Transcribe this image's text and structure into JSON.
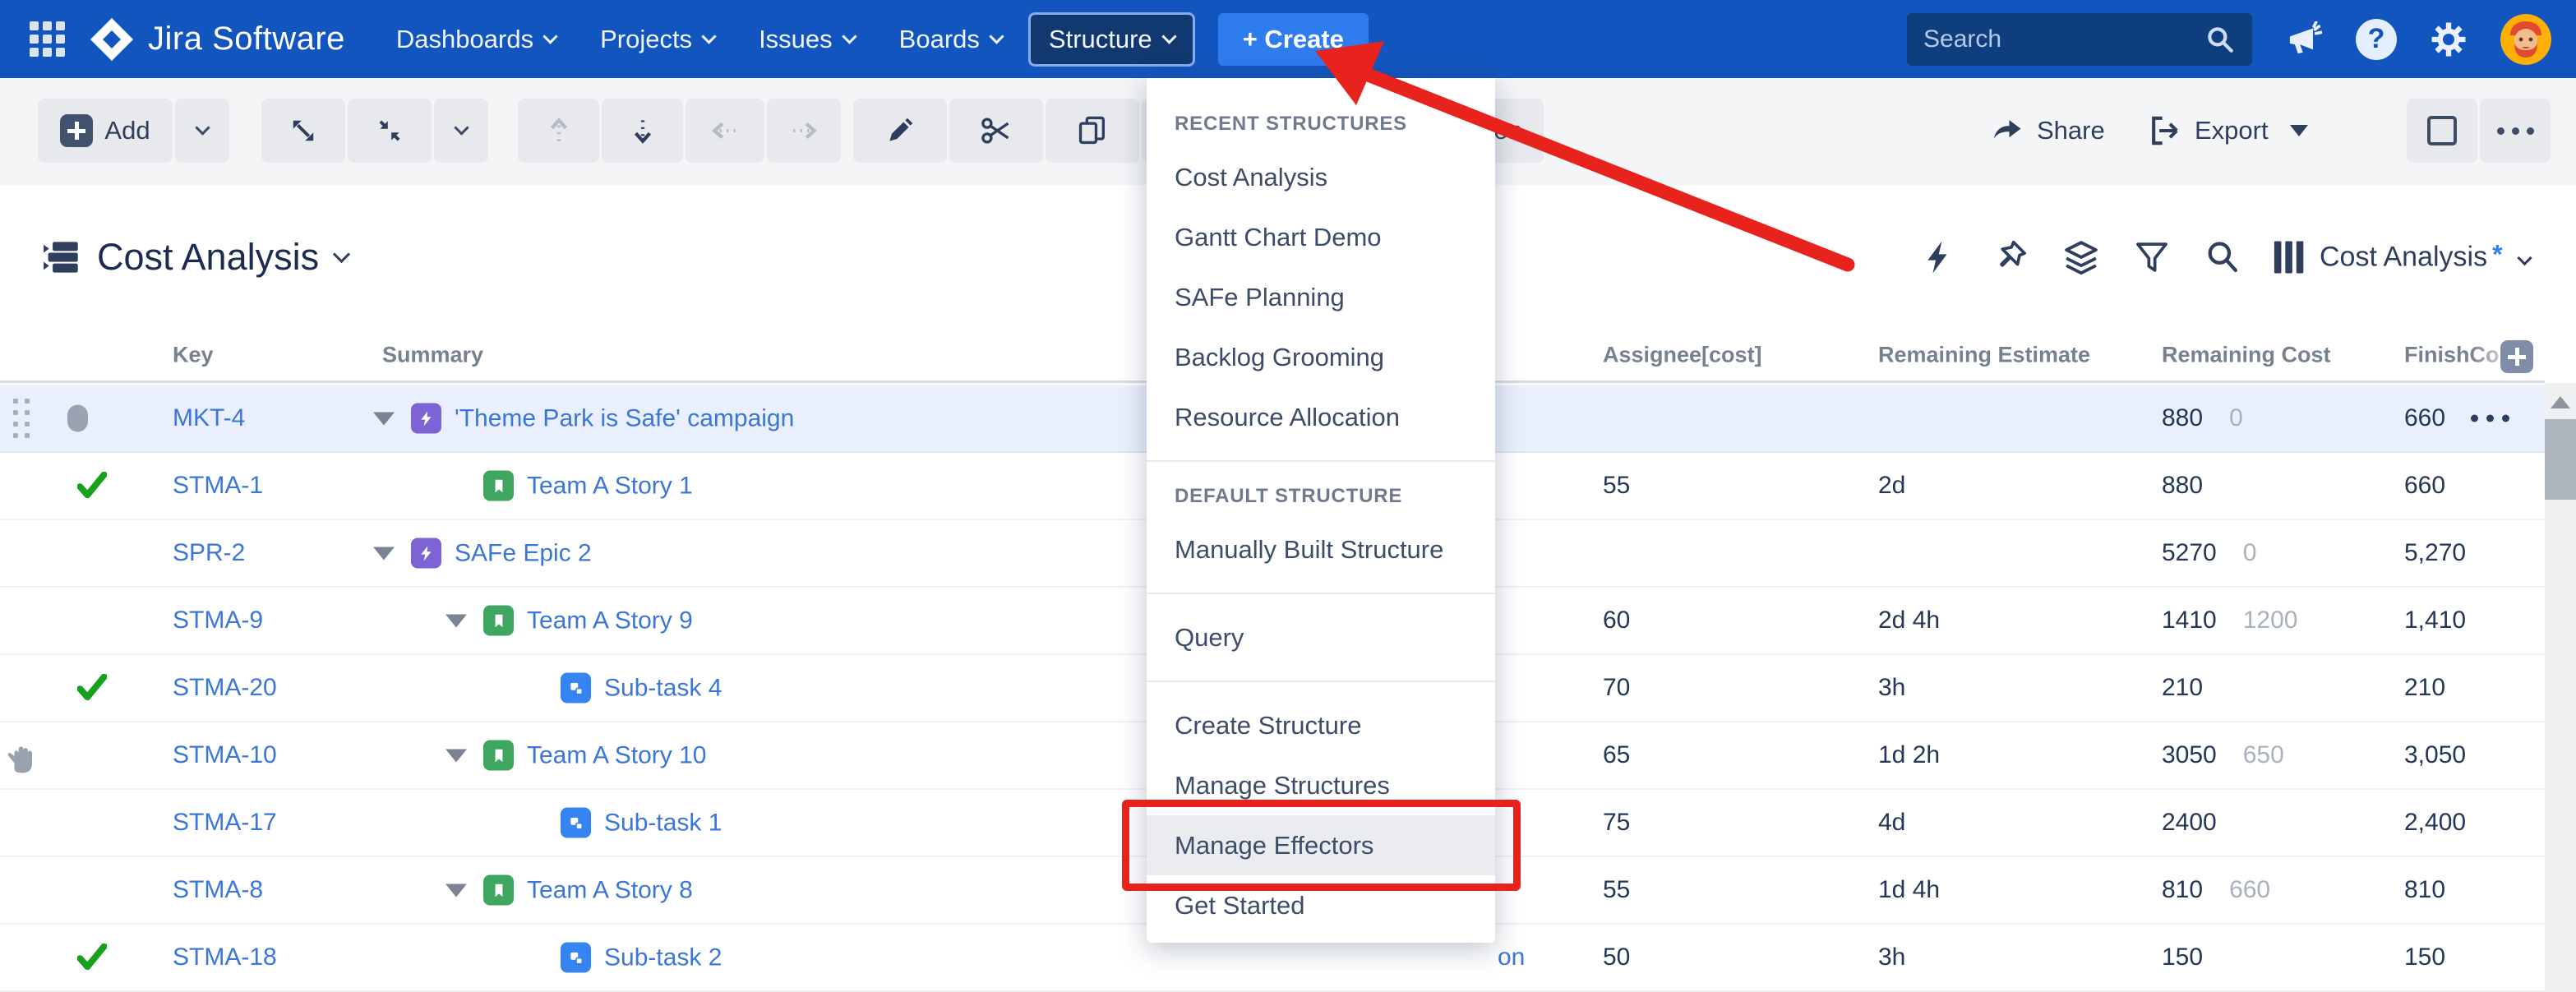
{
  "navbar": {
    "logo_text": "Jira Software",
    "items": [
      {
        "label": "Dashboards"
      },
      {
        "label": "Projects"
      },
      {
        "label": "Issues"
      },
      {
        "label": "Boards"
      },
      {
        "label": "Structure",
        "active": true
      }
    ],
    "create_label": "+ Create",
    "search_placeholder": "Search"
  },
  "toolbar": {
    "add_label": "Add",
    "hidden_button_visible_text": "on",
    "share_label": "Share",
    "export_label": "Export"
  },
  "titlebar": {
    "title": "Cost Analysis",
    "view_name": "Cost Analysis",
    "view_modified_mark": "*"
  },
  "menu": {
    "sections": [
      {
        "header": "RECENT STRUCTURES",
        "items": [
          "Cost Analysis",
          "Gantt Chart Demo",
          "SAFe Planning",
          "Backlog Grooming",
          "Resource Allocation"
        ]
      },
      {
        "header": "DEFAULT STRUCTURE",
        "items": [
          "Manually Built Structure"
        ]
      },
      {
        "header": "",
        "items": [
          "Query"
        ]
      },
      {
        "header": "",
        "items": [
          "Create Structure",
          "Manage Structures",
          "Manage Effectors",
          "Get Started"
        ]
      }
    ],
    "highlighted_item": "Manage Effectors"
  },
  "table": {
    "headers": [
      "Key",
      "Summary",
      "Assignee[cost]",
      "Remaining Estimate",
      "Remaining Cost",
      "FinishCo"
    ],
    "clipped_link_text": "on",
    "rows": [
      {
        "key": "MKT-4",
        "summary": "'Theme Park is Safe' campaign",
        "type": "epic",
        "assignee": "",
        "estimate": "",
        "cost": "880",
        "cost2": "0",
        "finish": "660"
      },
      {
        "key": "STMA-1",
        "summary": "Team A Story 1",
        "type": "story",
        "assignee": "55",
        "estimate": "2d",
        "cost": "880",
        "cost2": "",
        "finish": "660"
      },
      {
        "key": "SPR-2",
        "summary": "SAFe Epic 2",
        "type": "epic",
        "assignee": "",
        "estimate": "",
        "cost": "5270",
        "cost2": "0",
        "finish": "5,270"
      },
      {
        "key": "STMA-9",
        "summary": "Team A Story 9",
        "type": "story",
        "assignee": "60",
        "estimate": "2d 4h",
        "cost": "1410",
        "cost2": "1200",
        "finish": "1,410"
      },
      {
        "key": "STMA-20",
        "summary": "Sub-task 4",
        "type": "subtask",
        "assignee": "70",
        "estimate": "3h",
        "cost": "210",
        "cost2": "",
        "finish": "210"
      },
      {
        "key": "STMA-10",
        "summary": "Team A Story 10",
        "type": "story",
        "assignee": "65",
        "estimate": "1d 2h",
        "cost": "3050",
        "cost2": "650",
        "finish": "3,050"
      },
      {
        "key": "STMA-17",
        "summary": "Sub-task 1",
        "type": "subtask",
        "assignee": "75",
        "estimate": "4d",
        "cost": "2400",
        "cost2": "",
        "finish": "2,400"
      },
      {
        "key": "STMA-8",
        "summary": "Team A Story 8",
        "type": "story",
        "assignee": "55",
        "estimate": "1d 4h",
        "cost": "810",
        "cost2": "660",
        "finish": "810"
      },
      {
        "key": "STMA-18",
        "summary": "Sub-task 2",
        "type": "subtask",
        "assignee": "50",
        "estimate": "3h",
        "cost": "150",
        "cost2": "",
        "finish": "150"
      }
    ]
  },
  "colors": {
    "navbar_bg": "#1355BE",
    "create_btn": "#2F7CEF",
    "link_blue": "#3B76D9",
    "epic_purple": "#7E63D5",
    "story_green": "#3EA65F",
    "subtask_blue": "#3684F2",
    "check_green": "#17A11C",
    "annotation_red": "#E8231E",
    "selected_row_bg": "#E9EFFC"
  }
}
